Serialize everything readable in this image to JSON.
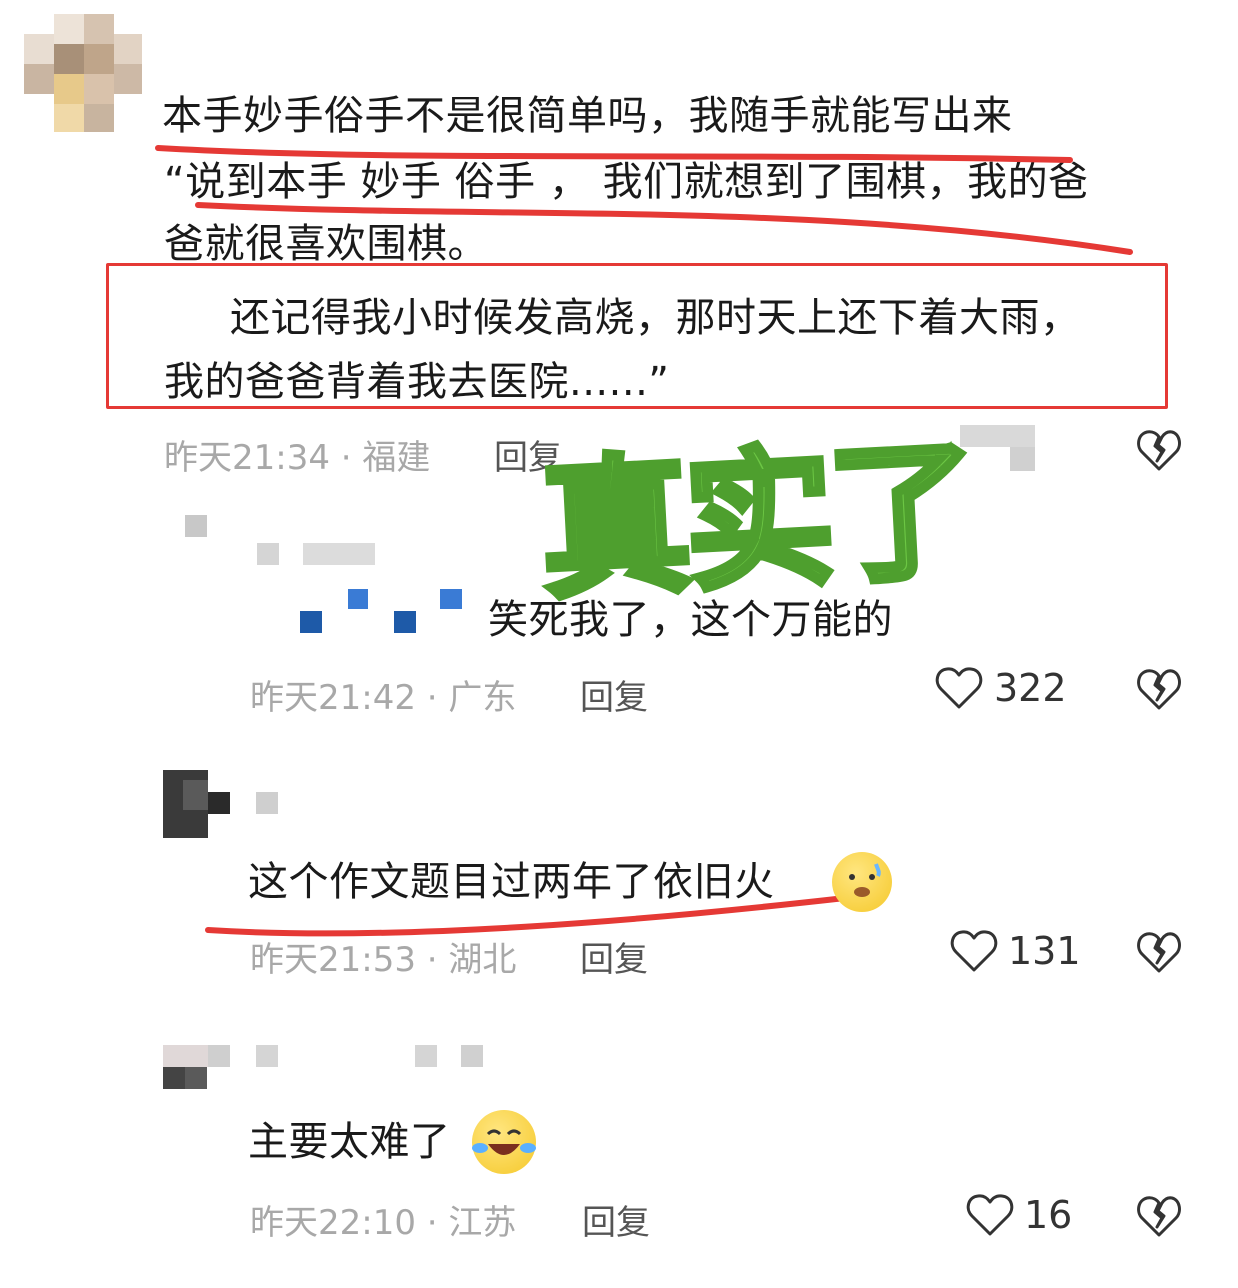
{
  "comments": [
    {
      "text_lines": [
        "本手妙手俗手不是很简单吗，我随手就能写出来",
        "“说到本手 妙手 俗手 ， 我们就想到了围棋，我的爸",
        "爸就很喜欢围棋。",
        "还记得我小时候发高烧，那时天上还下着大雨，",
        "我的爸爸背着我去医院......”"
      ],
      "time": "昨天21:34",
      "location": "福建",
      "reply": "回复"
    },
    {
      "text": "笑死我了，这个万能的",
      "time": "昨天21:42",
      "location": "广东",
      "reply": "回复",
      "likes": "322"
    },
    {
      "text": "这个作文题目过两年了依旧火",
      "time": "昨天21:53",
      "location": "湖北",
      "reply": "回复",
      "likes": "131"
    },
    {
      "text": "主要太难了",
      "time": "昨天22:10",
      "location": "江苏",
      "reply": "回复",
      "likes": "16"
    }
  ],
  "overlay_stamp": "真实了",
  "colors": {
    "red_annotation": "#e53935",
    "stamp_green": "#6cc644",
    "meta_gray": "#a8a8a8"
  },
  "icons": [
    "heart-icon",
    "broken-heart-icon",
    "sweat-emoji-icon",
    "laugh-cry-emoji-icon"
  ]
}
